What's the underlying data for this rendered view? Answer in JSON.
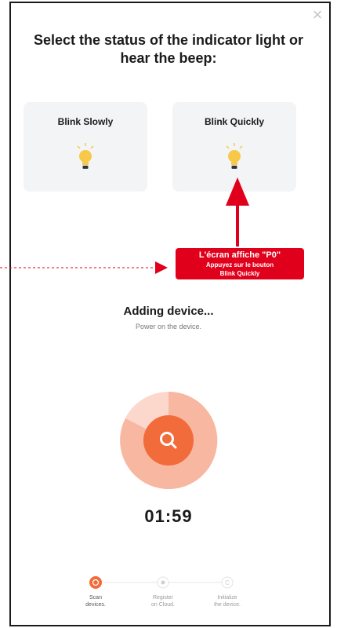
{
  "header": {
    "title": "Select the status of the indicator light or hear the beep:",
    "close_icon": "close-icon"
  },
  "options": [
    {
      "label": "Blink Slowly",
      "icon": "lightbulb-icon"
    },
    {
      "label": "Blink Quickly",
      "icon": "lightbulb-icon"
    }
  ],
  "annotation": {
    "line1": "L'écran affiche \"P0\"",
    "line2": "Appuyez sur le bouton",
    "line3": "Blink Quickly",
    "color": "#e0001b"
  },
  "status": {
    "title": "Adding device...",
    "subtitle": "Power on the device."
  },
  "timer": "01:59",
  "progress_steps": [
    {
      "label_line1": "Scan",
      "label_line2": "devices.",
      "active": true
    },
    {
      "label_line1": "Register",
      "label_line2": "on Cloud.",
      "active": false
    },
    {
      "label_line1": "Initialize",
      "label_line2": "the device.",
      "active": false
    }
  ],
  "colors": {
    "accent": "#f26b3a",
    "accent_light": "#f7b7a0",
    "card_bg": "#f3f4f6",
    "bulb": "#f7c84a"
  }
}
